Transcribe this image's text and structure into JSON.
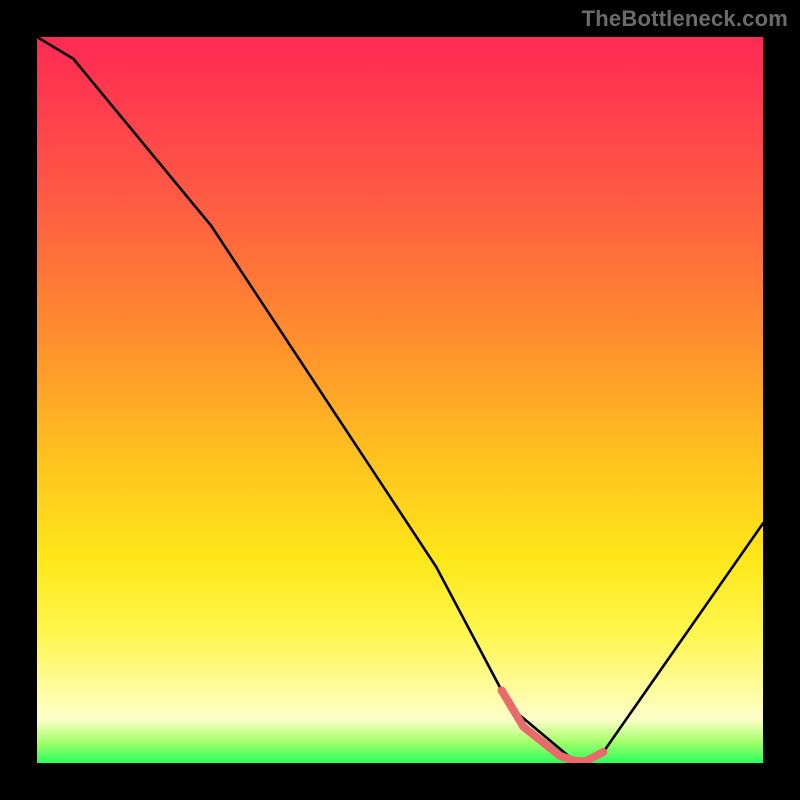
{
  "watermark": "TheBottleneck.com",
  "chart_data": {
    "type": "line",
    "title": "",
    "xlabel": "",
    "ylabel": "",
    "xlim": [
      0,
      100
    ],
    "ylim": [
      0,
      100
    ],
    "series": [
      {
        "name": "black-curve",
        "x": [
          0,
          5,
          24,
          55,
          64,
          66,
          74,
          75.5,
          78,
          100
        ],
        "y": [
          100,
          97,
          74,
          27,
          10,
          7,
          0.3,
          0.2,
          1.5,
          33
        ]
      },
      {
        "name": "pink-valley-highlight",
        "x": [
          64,
          67,
          72,
          74,
          75.5,
          78
        ],
        "y": [
          10,
          5,
          1,
          0.3,
          0.2,
          1.5
        ]
      }
    ],
    "colors": {
      "curve": "#000000",
      "highlight": "#e96a6a",
      "gradient_top": "#ff2a55",
      "gradient_mid": "#ffe71a",
      "gradient_bottom": "#2bff5a"
    }
  }
}
